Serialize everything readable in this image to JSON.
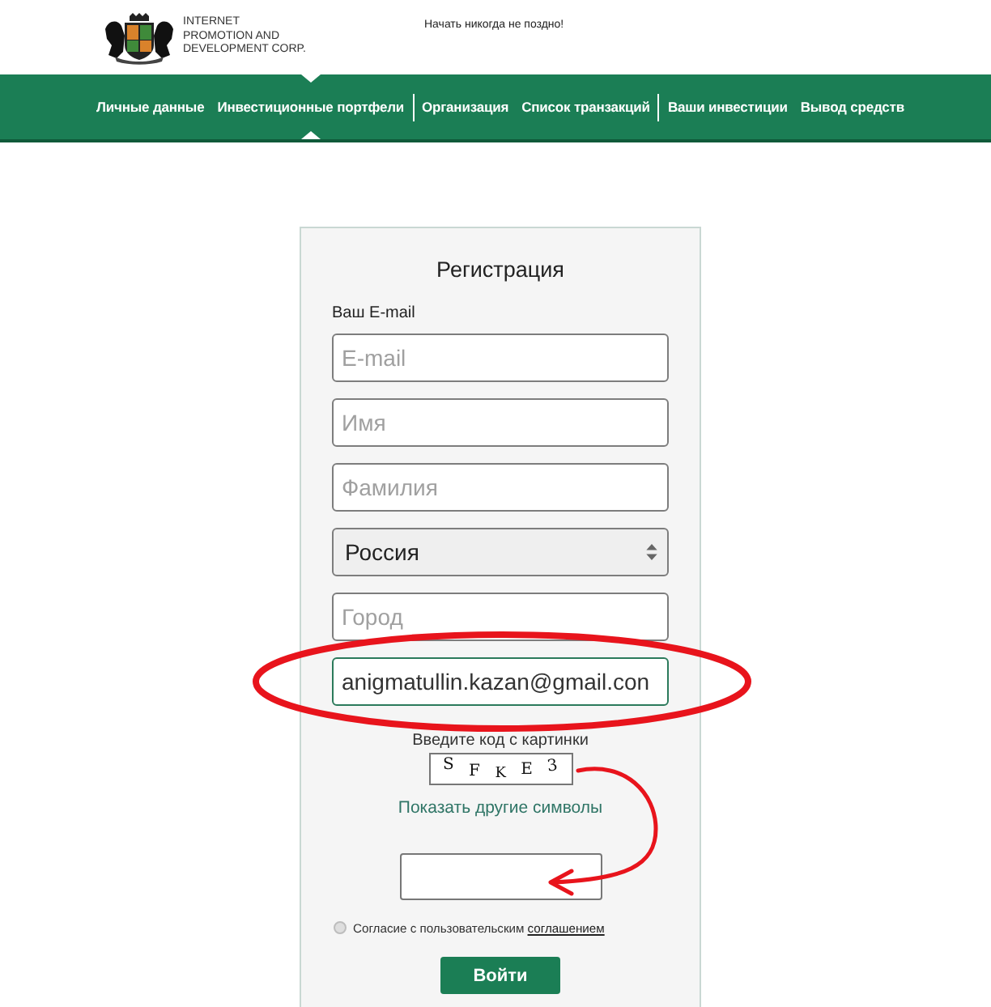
{
  "header": {
    "logo_lines": [
      "INTERNET",
      "PROMOTION AND",
      "DEVELOPMENT CORP."
    ],
    "slogan": "Начать никогда не поздно!"
  },
  "nav": {
    "groups": [
      {
        "items": [
          {
            "label": "Личные данные",
            "selected": false
          },
          {
            "label": "Инвестиционные портфели",
            "selected": true
          }
        ]
      },
      {
        "items": [
          {
            "label": "Организация",
            "selected": false
          },
          {
            "label": "Список транзакций",
            "selected": false
          }
        ]
      },
      {
        "items": [
          {
            "label": "Ваши инвестиции",
            "selected": false
          },
          {
            "label": "Вывод средств",
            "selected": false
          }
        ]
      }
    ]
  },
  "form": {
    "title": "Регистрация",
    "email_label": "Ваш E-mail",
    "fields": [
      {
        "kind": "input",
        "placeholder": "E-mail",
        "focused": false
      },
      {
        "kind": "input",
        "placeholder": "Имя",
        "focused": false
      },
      {
        "kind": "input",
        "placeholder": "Фамилия",
        "focused": false
      },
      {
        "kind": "select",
        "value": "Россия",
        "focused": false
      },
      {
        "kind": "input",
        "placeholder": "Город",
        "focused": false
      },
      {
        "kind": "input",
        "value": "anigmatullin.kazan@gmail.con",
        "focused": true
      }
    ],
    "captcha_label": "Введите код с картинки",
    "captcha": {
      "text": "S F K E 3"
    },
    "refresh_link": "Показать другие символы",
    "captcha_input": {
      "focused": false
    },
    "agreement": {
      "checked": false,
      "text": "Согласие с пользовательским",
      "link": "соглашением"
    },
    "submit": "Войти"
  },
  "annotations": [
    {
      "kind": "ellipse"
    },
    {
      "kind": "arrow"
    }
  ]
}
